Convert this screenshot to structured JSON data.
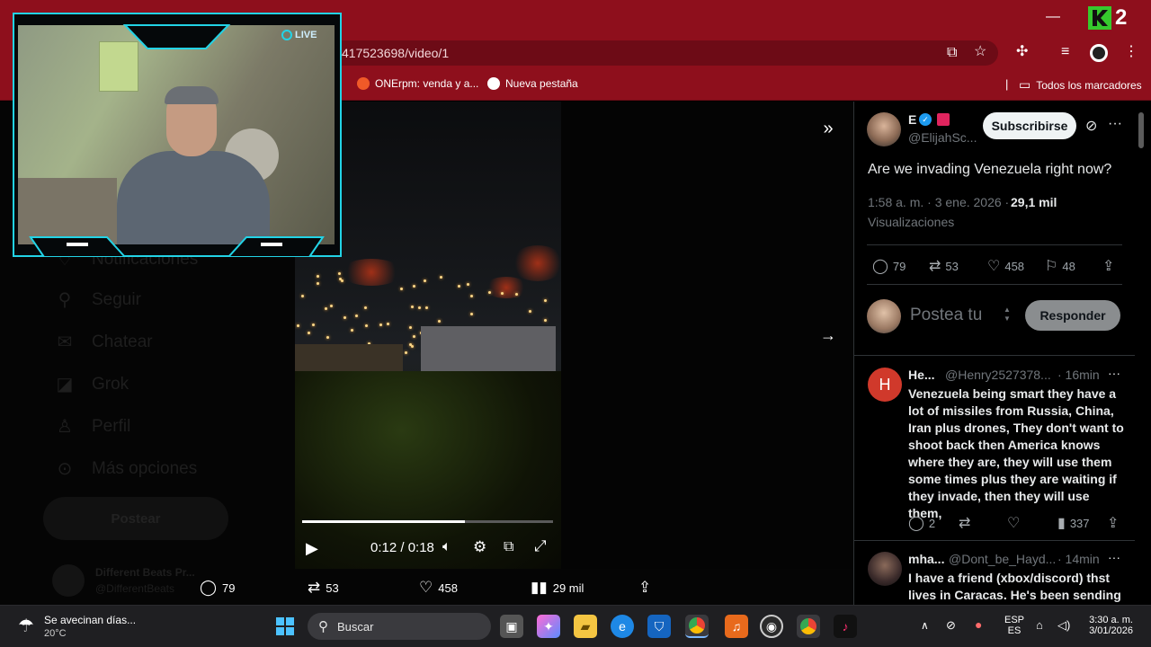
{
  "browser": {
    "url_fragment": "417523698/video/1",
    "bookmarks": [
      {
        "label": "ONErpm: venda y a...",
        "icon": "onerpm-icon"
      },
      {
        "label": "Nueva pestaña",
        "icon": "globe-icon"
      }
    ],
    "all_bookmarks": "Todos los marcadores",
    "badge": "2"
  },
  "webcam": {
    "live_label": "LIVE"
  },
  "left_nav": {
    "items": [
      {
        "label": "Notificaciones",
        "icon": "bell-icon"
      },
      {
        "label": "Seguir",
        "icon": "add-person-icon"
      },
      {
        "label": "Chatear",
        "icon": "mail-icon"
      },
      {
        "label": "Grok",
        "icon": "grok-icon"
      },
      {
        "label": "Perfil",
        "icon": "person-icon"
      },
      {
        "label": "Más opciones",
        "icon": "more-circle-icon"
      }
    ],
    "post_label": "Postear",
    "account_name": "Different Beats Pr...",
    "account_handle": "@DifferentBeats"
  },
  "video": {
    "time": "0:12 / 0:18",
    "progress": 0.65,
    "stats": {
      "replies": "79",
      "reposts": "53",
      "likes": "458",
      "views": "29 mil"
    }
  },
  "post": {
    "author_name": "E",
    "author_handle": "@ElijahSc...",
    "subscribe_label": "Subscribirse",
    "text": "Are we invading Venezuela right now?",
    "time": "1:58 a. m. · 3 ene. 2026 ·",
    "views_count": "29,1 mil",
    "views_label": "Visualizaciones",
    "replies": "79",
    "reposts": "53",
    "likes": "458",
    "bookmarks": "48",
    "reply_placeholder": "Postea tu",
    "reply_button": "Responder"
  },
  "replies": [
    {
      "initial": "H",
      "avatar_color": "#d0392b",
      "name": "He...",
      "handle": "@Henry2527378...",
      "age": "· 16min",
      "text": "Venezuela being smart they have a lot of missiles from Russia, China, Iran plus drones, They don't want to shoot back then America knows where they are, they will use them some times plus they are waiting if they invade, then they will use them,",
      "replies": "2",
      "views": "337"
    },
    {
      "initial": "",
      "avatar_color": "#3b3b3b",
      "name": "mha...",
      "handle": "@Dont_be_Hayd...",
      "age": "· 14min",
      "text": "I have a friend (xbox/discord) thst lives in Caracas. He's been sending"
    }
  ],
  "taskbar": {
    "weather_title": "Se avecinan días...",
    "weather_temp": "20°C",
    "search_placeholder": "Buscar",
    "lang_top": "ESP",
    "lang_bottom": "ES",
    "clock_time": "3:30 a. m.",
    "clock_date": "3/01/2026"
  },
  "colors": {
    "chrome_red": "#8e0f1c",
    "webcam_border": "#22d3e6",
    "verified_blue": "#1d9bf0"
  }
}
